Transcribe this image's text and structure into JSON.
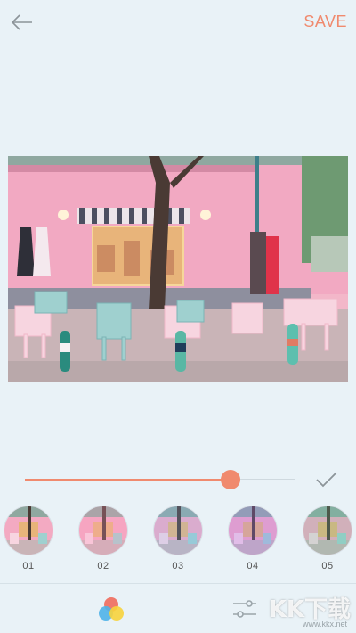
{
  "header": {
    "back_icon": "arrow-left-icon",
    "save_label": "SAVE"
  },
  "photo": {
    "description_icon": "photo"
  },
  "intensity": {
    "value_fraction": 0.76
  },
  "filters": [
    {
      "label": "01"
    },
    {
      "label": "02"
    },
    {
      "label": "03"
    },
    {
      "label": "04"
    },
    {
      "label": "05"
    }
  ],
  "bottom_tabs": {
    "color_icon": "color-circles-icon",
    "adjust_icon": "sliders-icon"
  },
  "watermark": {
    "text": "KK下载",
    "url": "www.kkx.net"
  },
  "colors": {
    "accent": "#f08a6e",
    "background": "#e9f2f7"
  }
}
